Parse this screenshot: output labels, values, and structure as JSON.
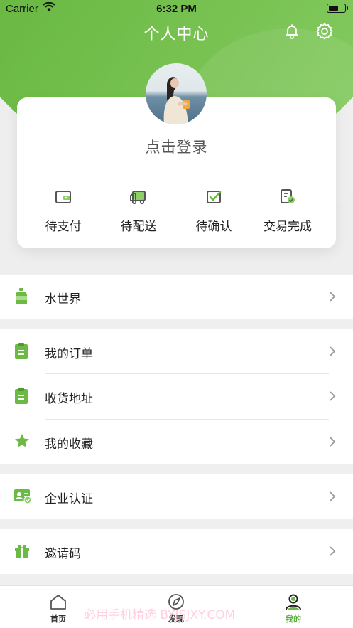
{
  "status_bar": {
    "carrier": "Carrier",
    "time": "6:32 PM"
  },
  "header": {
    "title": "个人中心",
    "icons": [
      "bell-icon",
      "gear-icon"
    ]
  },
  "profile": {
    "login_text": "点击登录"
  },
  "orders": [
    {
      "label": "待支付",
      "icon": "wallet-icon"
    },
    {
      "label": "待配送",
      "icon": "truck-icon"
    },
    {
      "label": "待确认",
      "icon": "checkbox-icon"
    },
    {
      "label": "交易完成",
      "icon": "document-check-icon"
    }
  ],
  "menu": {
    "water_world": "水世界",
    "my_orders": "我的订单",
    "address": "收货地址",
    "favorites": "我的收藏",
    "enterprise": "企业认证",
    "invite_code": "邀请码"
  },
  "tabbar": [
    {
      "label": "首页",
      "icon": "home-icon"
    },
    {
      "label": "发现",
      "icon": "compass-icon"
    },
    {
      "label": "我的",
      "icon": "user-icon"
    }
  ],
  "watermark": "必用手机精选 BYJSJXY.COM",
  "colors": {
    "accent": "#58ac3a",
    "header_green": "#6cba45",
    "background": "#efefef"
  }
}
